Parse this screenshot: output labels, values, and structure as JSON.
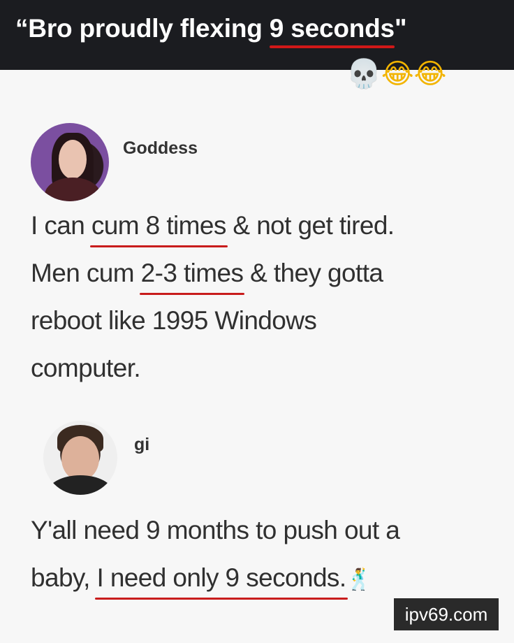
{
  "banner": {
    "title_prefix": "“Bro proudly flexing ",
    "title_highlight": "9 seconds",
    "title_suffix": "\"",
    "emojis": {
      "skull": "💀",
      "laugh1": "😂",
      "laugh2": "😂"
    },
    "highlight_color": "#d01818"
  },
  "post1": {
    "username": "Goddess",
    "lines": [
      {
        "pre": "I can ",
        "ul": "cum 8 times",
        "post": " & not get tired."
      },
      {
        "pre": "Men cum ",
        "ul": "2-3 times",
        "post": " & they gotta"
      },
      {
        "text": "reboot like 1995 Windows"
      },
      {
        "text": "computer."
      }
    ]
  },
  "post2": {
    "username": "gi",
    "lines": [
      {
        "text": "Y'all need 9 months to push out a"
      },
      {
        "pre": "baby, ",
        "ul": "I need only 9 seconds.",
        "emoji": "🕺"
      }
    ]
  },
  "watermark": "ipv69.com",
  "colors": {
    "banner_bg": "#1b1c20",
    "underline": "#c81c1c",
    "text": "#303030"
  }
}
